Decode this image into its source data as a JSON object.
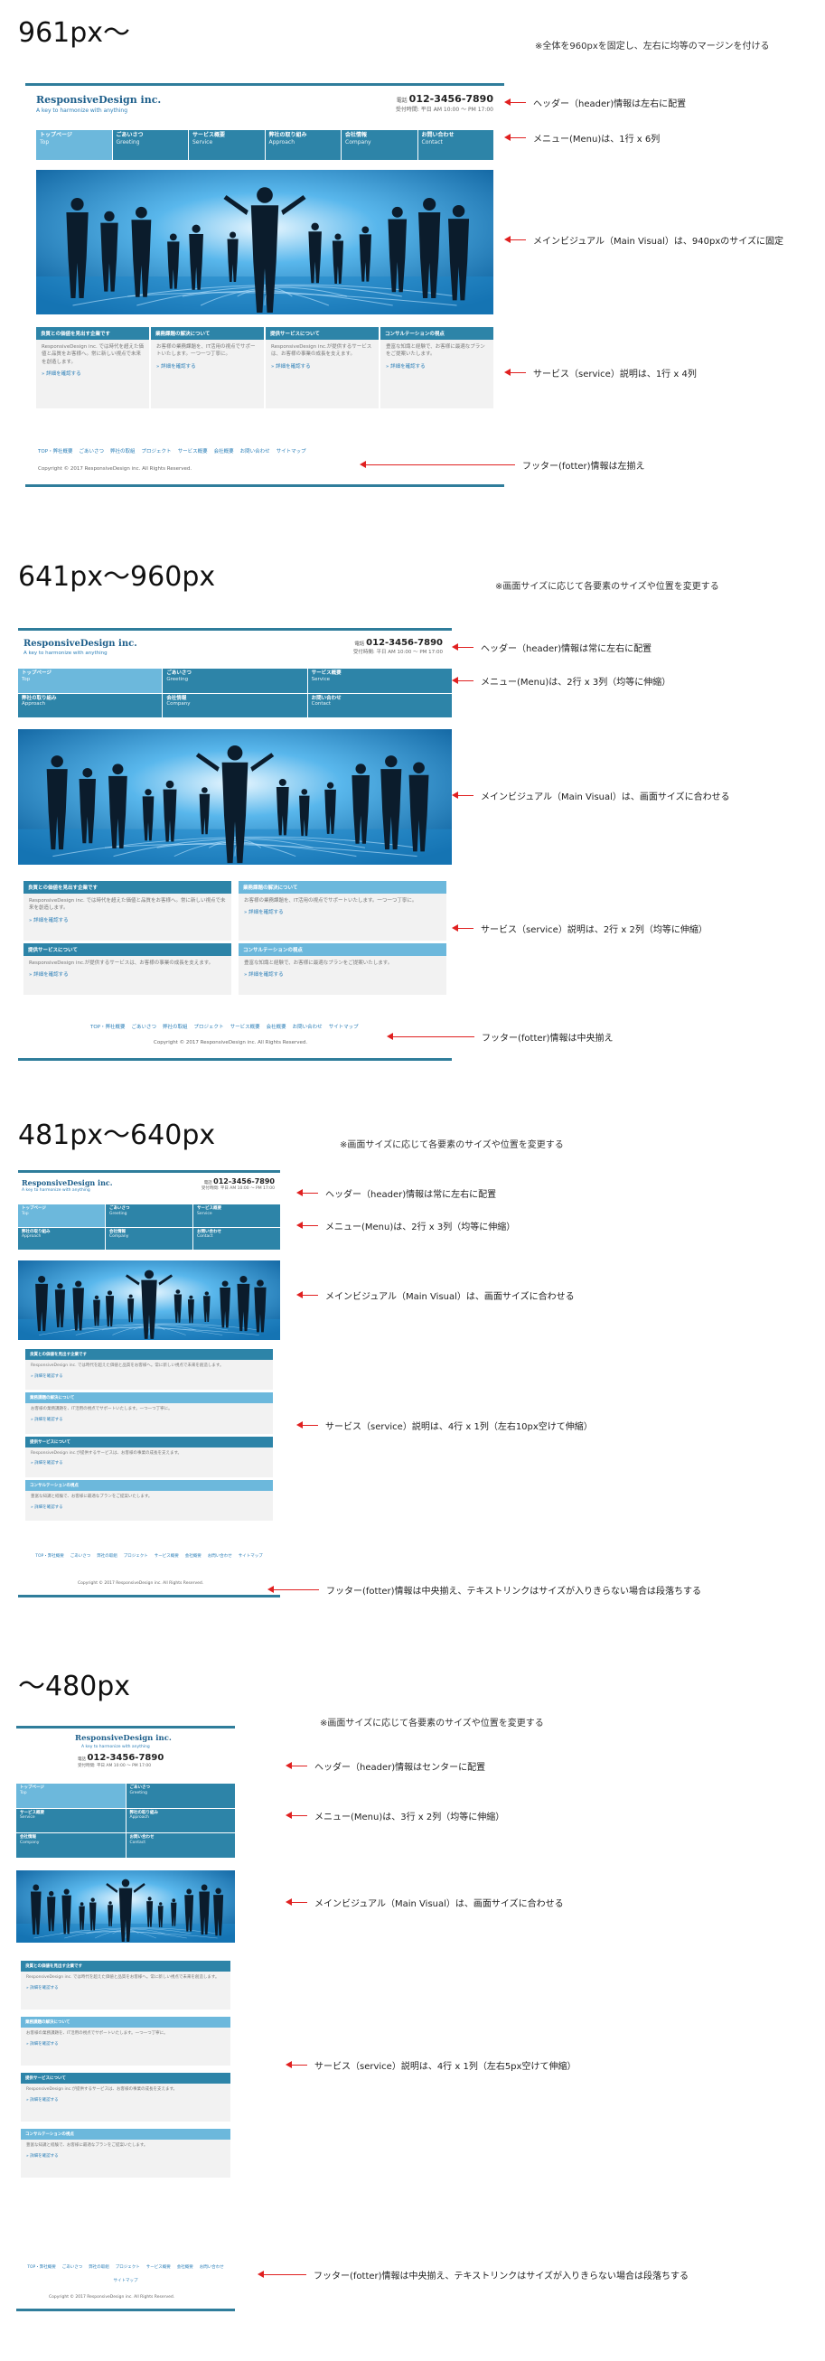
{
  "global_note": "※全体を960pxを固定し、左右に均等のマージンを付ける",
  "size_note": "※画面サイズに応じて各要素のサイズや位置を変更する",
  "site": {
    "logo": "ResponsiveDesign inc.",
    "tagline": "A key to harmonize with anything",
    "tel_label": "電話",
    "tel": "012-3456-7890",
    "hours": "受付時間: 平日 AM 10:00 〜 PM 17:00",
    "menu": [
      {
        "ja": "トップページ",
        "en": "Top"
      },
      {
        "ja": "ごあいさつ",
        "en": "Greeting"
      },
      {
        "ja": "サービス概要",
        "en": "Service"
      },
      {
        "ja": "弊社の取り組み",
        "en": "Approach"
      },
      {
        "ja": "会社情報",
        "en": "Company"
      },
      {
        "ja": "お問い合わせ",
        "en": "Contact"
      }
    ],
    "services": [
      {
        "title": "良質との価値を見出す企業です",
        "body": "ResponsiveDesign inc. では時代を超えた価値と品質をお客様へ。常に新しい視点で未来を創造します。",
        "link": "» 詳細を確認する"
      },
      {
        "title": "業務課題の解決について",
        "body": "お客様の業務課題を、IT活用の視点でサポートいたします。一つ一つ丁寧に。",
        "link": "» 詳細を確認する"
      },
      {
        "title": "提供サービスについて",
        "body": "ResponsiveDesign inc.が提供するサービスは、お客様の事業の成長を支えます。",
        "link": "» 詳細を確認する"
      },
      {
        "title": "コンサルテーションの視点",
        "body": "豊富な知識と経験で、お客様に最適なプランをご提案いたします。",
        "link": "» 詳細を確認する"
      }
    ],
    "footer_links": [
      "TOP・弊社概要",
      "ごあいさつ",
      "弊社の取組",
      "プロジェクト",
      "サービス概要",
      "会社概要",
      "お問い合わせ",
      "サイトマップ"
    ],
    "copyright": "Copyright © 2017 ResponsiveDesign inc. All Rights Reserved."
  },
  "sections": [
    {
      "title": "961px〜",
      "annotations": [
        "ヘッダー（header)情報は左右に配置",
        "メニュー(Menu)は、1行 x 6列",
        "メインビジュアル（Main Visual）は、940pxのサイズに固定",
        "サービス（service）説明は、1行 x 4列",
        "フッター(fotter)情報は左揃え"
      ]
    },
    {
      "title": "641px〜960px",
      "annotations": [
        "ヘッダー（header)情報は常に左右に配置",
        "メニュー(Menu)は、2行 x 3列（均等に伸縮）",
        "メインビジュアル（Main Visual）は、画面サイズに合わせる",
        "サービス（service）説明は、2行 x 2列（均等に伸縮）",
        "フッター(fotter)情報は中央揃え"
      ]
    },
    {
      "title": "481px〜640px",
      "annotations": [
        "ヘッダー（header)情報は常に左右に配置",
        "メニュー(Menu)は、2行 x 3列（均等に伸縮）",
        "メインビジュアル（Main Visual）は、画面サイズに合わせる",
        "サービス（service）説明は、4行 x 1列（左右10px空けて伸縮）",
        "フッター(fotter)情報は中央揃え、テキストリンクはサイズが入りきらない場合は段落ちする"
      ]
    },
    {
      "title": "〜480px",
      "annotations": [
        "ヘッダー（header)情報はセンターに配置",
        "メニュー(Menu)は、3行 x 2列（均等に伸縮）",
        "メインビジュアル（Main Visual）は、画面サイズに合わせる",
        "サービス（service）説明は、4行 x 1列（左右5px空けて伸縮）",
        "フッター(fotter)情報は中央揃え、テキストリンクはサイズが入りきらない場合は段落ちする"
      ]
    }
  ]
}
